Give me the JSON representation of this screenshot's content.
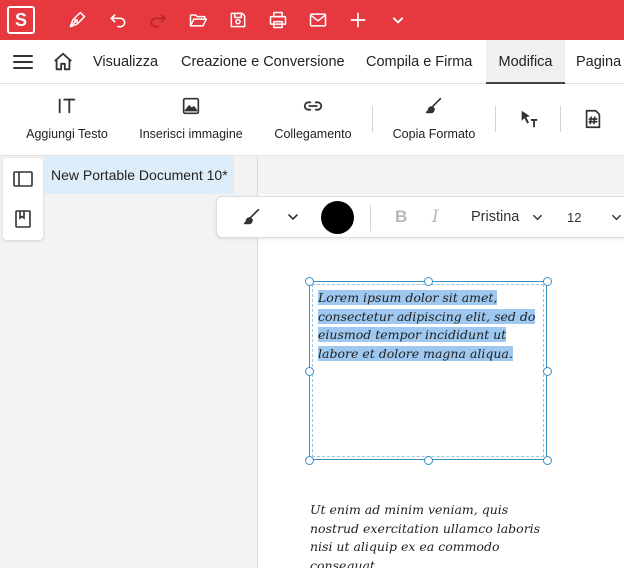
{
  "app": {
    "logo_letter": "S"
  },
  "quick_access": [
    {
      "icon": "pen-icon"
    },
    {
      "icon": "undo-icon"
    },
    {
      "icon": "redo-icon"
    },
    {
      "icon": "folder-open-icon"
    },
    {
      "icon": "save-icon"
    },
    {
      "icon": "print-icon"
    },
    {
      "icon": "mail-icon"
    },
    {
      "icon": "plus-icon"
    },
    {
      "icon": "chevron-down-icon"
    }
  ],
  "menu": {
    "tabs": [
      "Visualizza",
      "Creazione e Conversione",
      "Compila e Firma",
      "Modifica",
      "Pagina"
    ],
    "active": "Modifica"
  },
  "toolbar": {
    "add_text": "Aggiungi Testo",
    "insert_image": "Inserisci immagine",
    "link": "Collegamento",
    "copy_format": "Copia Formato"
  },
  "document": {
    "tab_title": "New Portable Document 10*",
    "selected_text": "Lorem ipsum dolor sit amet, consectetur adipiscing elit, sed do eiusmod tempor incididunt ut labore et dolore magna aliqua.",
    "body_text": "Ut enim ad minim veniam, quis nostrud exercitation ullamco laboris nisi ut aliquip ex ea commodo consequat."
  },
  "format_bar": {
    "font_name": "Pristina",
    "font_size": "12",
    "bold_label": "B",
    "italic_label": "I",
    "color": "#000000"
  },
  "colors": {
    "brand": "#e5393f",
    "selection": "#9ec8ef",
    "frame": "#3a8fc4"
  }
}
